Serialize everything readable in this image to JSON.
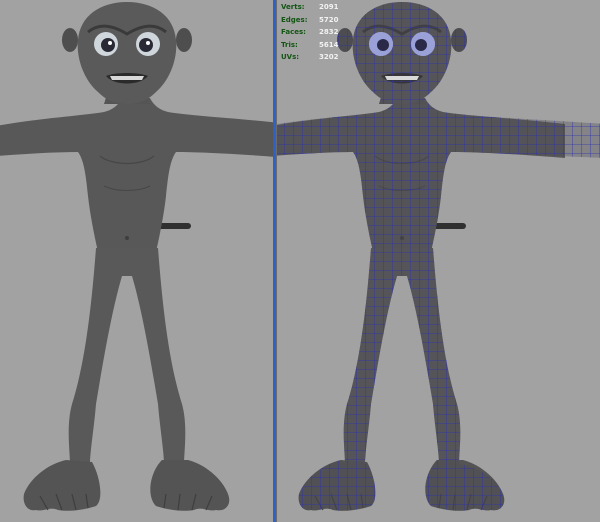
{
  "colors": {
    "viewport_bg": "#a2a2a2",
    "shaded_body": "#585858",
    "wire_body": "#4e4e58",
    "wire_lines": "#2b2fb0",
    "hud_label": "#135613",
    "hud_value": "#f2f2f2",
    "divider_accent": "#2f62c8"
  },
  "viewports": {
    "left": {
      "display_mode": "smooth shaded"
    },
    "right": {
      "display_mode": "wireframe on shaded"
    }
  },
  "hud": {
    "stats": [
      {
        "label": "Verts:",
        "value": "2091"
      },
      {
        "label": "Edges:",
        "value": "5720"
      },
      {
        "label": "Faces:",
        "value": "2832"
      },
      {
        "label": "Tris:",
        "value": "5614"
      },
      {
        "label": "UVs:",
        "value": "3202"
      }
    ]
  }
}
